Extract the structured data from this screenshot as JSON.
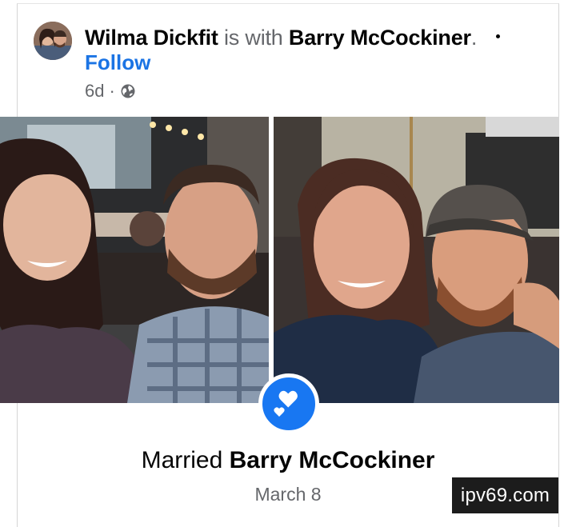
{
  "post": {
    "author_name": "Wilma Dickfit",
    "with_text": " is with ",
    "tagged_name": "Barry McCockiner",
    "tagged_suffix": ".",
    "follow_label": "Follow",
    "time": "6d",
    "time_separator": "·",
    "privacy_icon": "globe-icon",
    "menu_icon": "more-dot-icon",
    "avatar_icon": "profile-photo"
  },
  "photos": [
    {
      "name": "left-couple-photo",
      "description_icon": "couple-selfie-photo"
    },
    {
      "name": "right-couple-photo",
      "description_icon": "couple-selfie-photo"
    }
  ],
  "life_event": {
    "icon": "hearts-icon",
    "prefix": "Married ",
    "partner": "Barry McCockiner",
    "date": "March 8"
  },
  "watermark": {
    "text": "ipv69.com"
  },
  "colors": {
    "link_blue": "#1b74e4",
    "badge_blue": "#1877f2",
    "muted_text": "#65676b",
    "primary_text": "#050505"
  }
}
